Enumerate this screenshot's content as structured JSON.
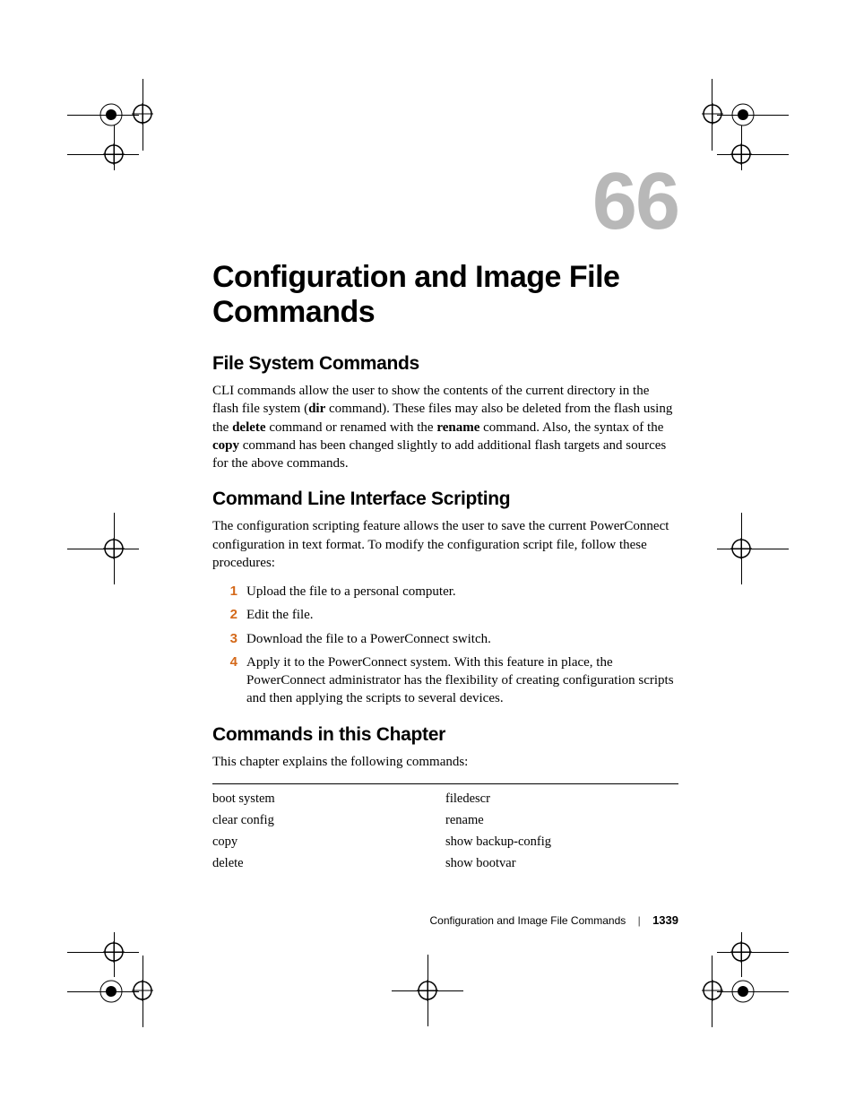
{
  "chapter_number": "66",
  "chapter_title": "Configuration and Image File Commands",
  "sections": {
    "fs": {
      "heading": "File System Commands",
      "para_parts": [
        "CLI commands allow the user to show the contents of the current directory in the flash file system (",
        "dir",
        " command).  These files may also be deleted from the flash using the ",
        "delete",
        " command or renamed with the ",
        "rename",
        " command. Also, the syntax of the ",
        "copy",
        " command has been changed slightly to add additional flash targets and sources for the above commands."
      ]
    },
    "cli": {
      "heading": "Command Line Interface Scripting",
      "para": "The configuration scripting feature allows the user to save the current PowerConnect configuration in text format. To modify the configuration script file, follow these procedures:",
      "steps": [
        "Upload the file to a personal computer.",
        "Edit the file.",
        "Download the file to a PowerConnect switch.",
        "Apply it to the PowerConnect system. With this feature in place, the PowerConnect administrator has the flexibility of creating configuration scripts and then applying the scripts to several devices."
      ],
      "nums": [
        "1",
        "2",
        "3",
        "4"
      ]
    },
    "commands": {
      "heading": "Commands in this Chapter",
      "para": "This chapter explains the following commands:",
      "left": [
        "boot system",
        "clear config",
        "copy",
        "delete"
      ],
      "right": [
        "filedescr",
        "rename",
        "show backup-config",
        "show bootvar"
      ]
    }
  },
  "footer": {
    "title": "Configuration and Image File Commands",
    "page": "1339"
  }
}
